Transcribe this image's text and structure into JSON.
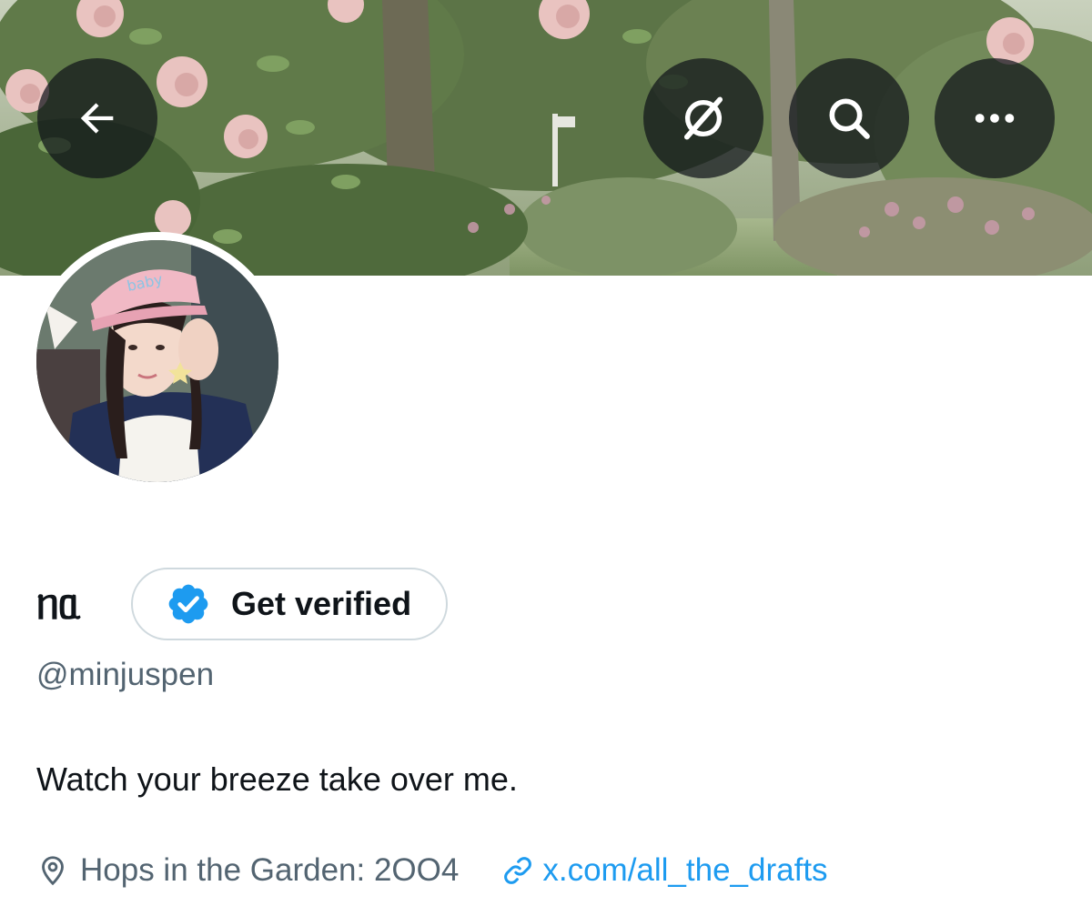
{
  "header": {
    "back_icon": "arrow-left-icon",
    "grok_icon": "grok-slash-icon",
    "search_icon": "search-icon",
    "more_icon": "more-dots-icon"
  },
  "profile": {
    "display_name": "ᥒᥲ",
    "get_verified_label": "Get verified",
    "verified_badge_color": "#1d9bf0",
    "handle": "@minjuspen",
    "bio": "Watch your breeze take over me.",
    "location": "Hops in the Garden: 2OO4",
    "website": "x.com/all_the_drafts"
  },
  "avatar_cap_text": "baby",
  "colors": {
    "link": "#1d9bf0",
    "secondary_text": "#536471",
    "primary_text": "#0f1419",
    "button_border": "#cfd9de"
  }
}
